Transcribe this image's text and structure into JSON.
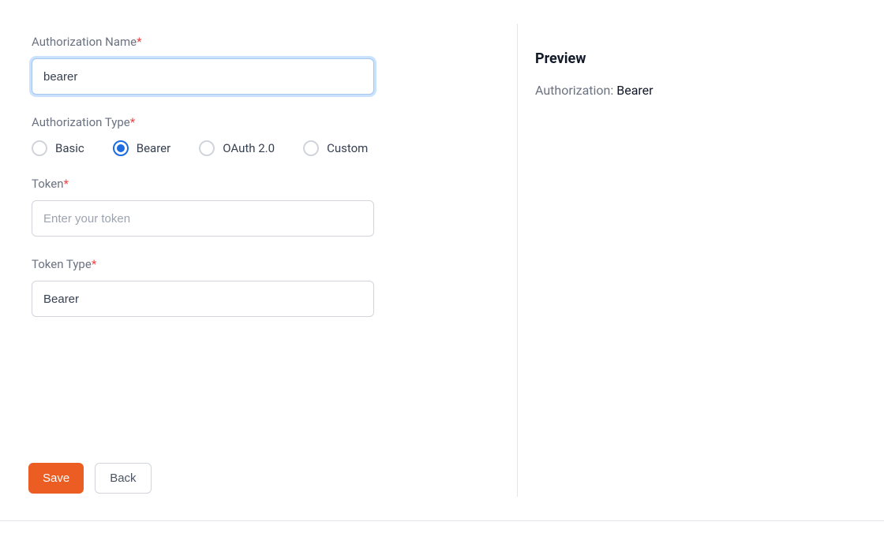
{
  "form": {
    "authName": {
      "label": "Authorization Name",
      "value": "bearer"
    },
    "authType": {
      "label": "Authorization Type",
      "options": [
        {
          "label": "Basic",
          "selected": false
        },
        {
          "label": "Bearer",
          "selected": true
        },
        {
          "label": "OAuth 2.0",
          "selected": false
        },
        {
          "label": "Custom",
          "selected": false
        }
      ]
    },
    "token": {
      "label": "Token",
      "placeholder": "Enter your token",
      "value": ""
    },
    "tokenType": {
      "label": "Token Type",
      "value": "Bearer"
    }
  },
  "buttons": {
    "save": "Save",
    "back": "Back"
  },
  "preview": {
    "title": "Preview",
    "key": "Authorization: ",
    "value": "Bearer"
  },
  "requiredMark": "*"
}
